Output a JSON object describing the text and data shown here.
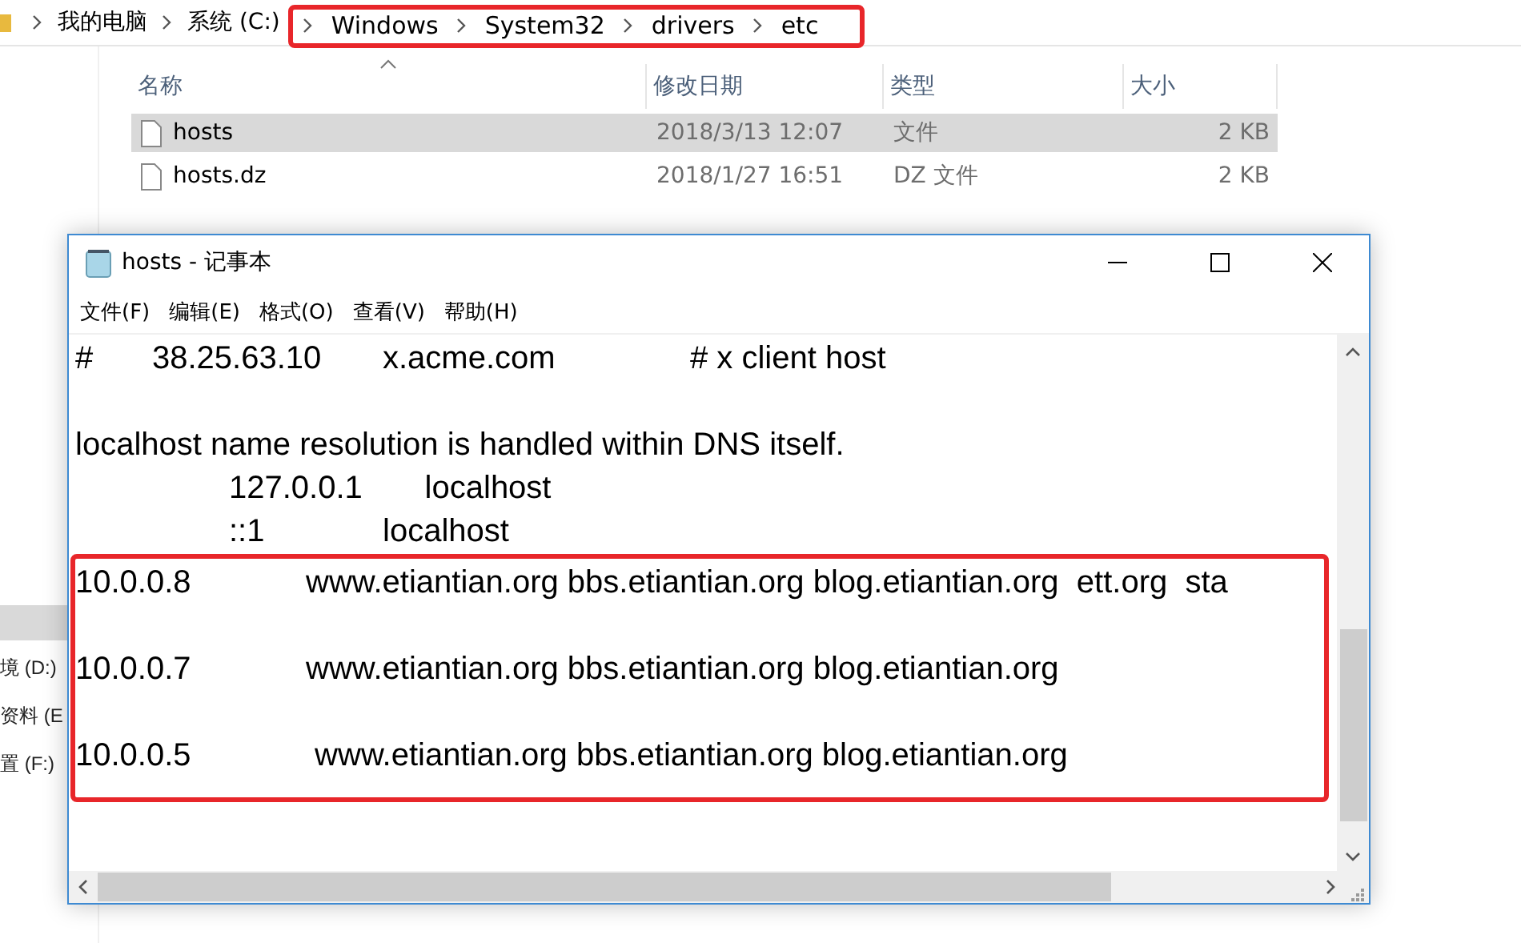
{
  "breadcrumb": {
    "items": [
      "我的电脑",
      "系统 (C:)"
    ],
    "highlighted_items": [
      "Windows",
      "System32",
      "drivers",
      "etc"
    ]
  },
  "file_list": {
    "columns": [
      {
        "label": "名称",
        "sorted": true
      },
      {
        "label": "修改日期",
        "sorted": false
      },
      {
        "label": "类型",
        "sorted": false
      },
      {
        "label": "大小",
        "sorted": false
      }
    ],
    "rows": [
      {
        "name": "hosts",
        "modified": "2018/3/13 12:07",
        "type": "文件",
        "size": "2 KB",
        "selected": true
      },
      {
        "name": "hosts.dz",
        "modified": "2018/1/27 16:51",
        "type": "DZ 文件",
        "size": "2 KB",
        "selected": false
      }
    ]
  },
  "nav_pane": {
    "items": [
      {
        "kind": "blank",
        "selected": true
      },
      {
        "kind": "text",
        "label": "境 (D:)",
        "selected": false
      },
      {
        "kind": "text",
        "label": "资料 (E",
        "selected": false
      },
      {
        "kind": "text",
        "label": "置 (F:)",
        "selected": false
      }
    ]
  },
  "notepad": {
    "title": "hosts - 记事本",
    "menu": [
      "文件(F)",
      "编辑(E)",
      "格式(O)",
      "查看(V)",
      "帮助(H)"
    ],
    "lines": [
      {
        "kind": "text",
        "text": "#\t38.25.63.10\tx.acme.com\t\t# x client host"
      },
      {
        "kind": "blank"
      },
      {
        "kind": "text",
        "text": "localhost name resolution is handled within DNS itself."
      },
      {
        "kind": "text",
        "text": "\t\t127.0.0.1       localhost"
      },
      {
        "kind": "text",
        "text": "\t\t::1\t\tlocalhost"
      }
    ],
    "highlighted_lines": [
      {
        "kind": "text",
        "text": "10.0.0.8\t\twww.etiantian.org bbs.etiantian.org blog.etiantian.org  ett.org  sta"
      },
      {
        "kind": "blank"
      },
      {
        "kind": "text",
        "text": "10.0.0.7\t\twww.etiantian.org bbs.etiantian.org blog.etiantian.org"
      },
      {
        "kind": "blank"
      },
      {
        "kind": "text",
        "text": "10.0.0.5\t\t www.etiantian.org bbs.etiantian.org blog.etiantian.org"
      }
    ]
  }
}
